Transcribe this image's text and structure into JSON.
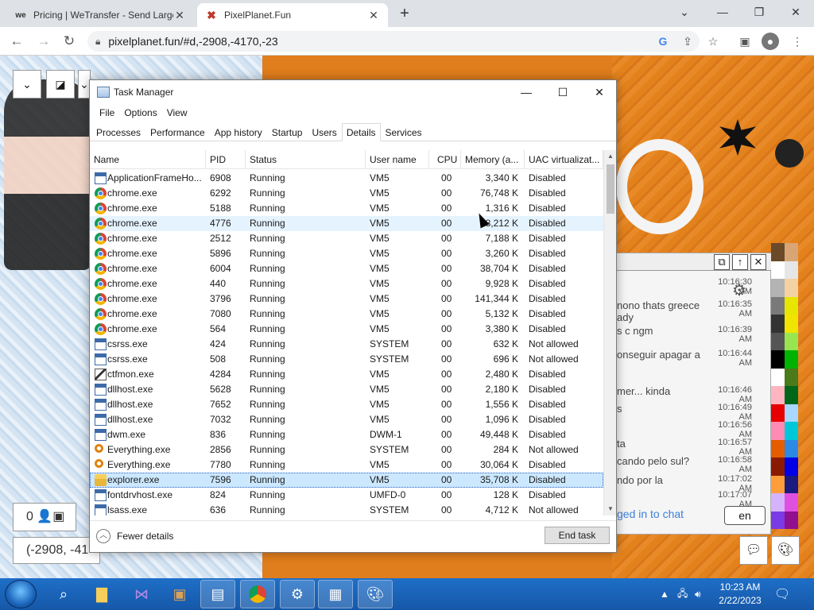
{
  "browser": {
    "tabs": [
      {
        "favicon": "we",
        "title": "Pricing | WeTransfer - Send Large"
      },
      {
        "favicon": "pixelplanet-icon",
        "title": "PixelPlanet.Fun"
      }
    ],
    "url": "pixelplanet.fun/#d,-2908,-4170,-23"
  },
  "pixelplanet": {
    "coords": "(-2908, -41",
    "online": "0",
    "chat": {
      "messages": [
        {
          "text": "",
          "time": "10:16:30 AM"
        },
        {
          "text": "nono thats greece",
          "text2": "ady",
          "time": "10:16:35 AM"
        },
        {
          "text": "s c ngm",
          "time": "10:16:39 AM"
        },
        {
          "text": "onseguir apagar a",
          "time": "10:16:44 AM"
        },
        {
          "text": "mer... kinda",
          "time": "10:16:46 AM"
        },
        {
          "text": "s",
          "time": "10:16:49 AM"
        },
        {
          "text": "",
          "time": "10:16:56 AM"
        },
        {
          "text": "ta",
          "time": "10:16:57 AM"
        },
        {
          "text": "cando pelo sul?",
          "time": "10:16:58 AM"
        },
        {
          "text": "ndo por la",
          "time": "10:17:02 AM"
        },
        {
          "text": "",
          "time": "10:17:07 AM"
        }
      ],
      "login_text": "ged in to chat",
      "lang": "en"
    },
    "palette": [
      "#6b4a2a",
      "#d8a675",
      "#ffffff",
      "#e6e6e6",
      "#b3b3b3",
      "#f3d1a1",
      "#7a7a7a",
      "#e6e600",
      "#333333",
      "#f0e400",
      "#555555",
      "#99e550",
      "#000000",
      "#00b300",
      "#ffffff",
      "#4a7a1a",
      "#ffb6c1",
      "#00661a",
      "#e60000",
      "#a8d8ff",
      "#ff8ab3",
      "#00c8d8",
      "#e65c00",
      "#2b8ae6",
      "#8a1a00",
      "#0000e6",
      "#ff9d3a",
      "#1a1a80",
      "#d6b3ff",
      "#e050e0",
      "#7a3ae6",
      "#901090"
    ]
  },
  "taskmanager": {
    "title": "Task Manager",
    "menu": [
      "File",
      "Options",
      "View"
    ],
    "tabs": [
      "Processes",
      "Performance",
      "App history",
      "Startup",
      "Users",
      "Details",
      "Services"
    ],
    "active_tab": "Details",
    "columns": [
      "Name",
      "PID",
      "Status",
      "User name",
      "CPU",
      "Memory (a...",
      "UAC virtualizat..."
    ],
    "rows": [
      {
        "icon": "app",
        "name": "ApplicationFrameHo...",
        "pid": "6908",
        "status": "Running",
        "user": "VM5",
        "cpu": "00",
        "mem": "3,340 K",
        "uac": "Disabled"
      },
      {
        "icon": "chrome",
        "name": "chrome.exe",
        "pid": "6292",
        "status": "Running",
        "user": "VM5",
        "cpu": "00",
        "mem": "76,748 K",
        "uac": "Disabled"
      },
      {
        "icon": "chrome",
        "name": "chrome.exe",
        "pid": "5188",
        "status": "Running",
        "user": "VM5",
        "cpu": "00",
        "mem": "1,316 K",
        "uac": "Disabled"
      },
      {
        "icon": "chrome",
        "name": "chrome.exe",
        "pid": "4776",
        "status": "Running",
        "user": "VM5",
        "cpu": "00",
        "mem": "8,212 K",
        "uac": "Disabled"
      },
      {
        "icon": "chrome",
        "name": "chrome.exe",
        "pid": "2512",
        "status": "Running",
        "user": "VM5",
        "cpu": "00",
        "mem": "7,188 K",
        "uac": "Disabled"
      },
      {
        "icon": "chrome",
        "name": "chrome.exe",
        "pid": "5896",
        "status": "Running",
        "user": "VM5",
        "cpu": "00",
        "mem": "3,260 K",
        "uac": "Disabled"
      },
      {
        "icon": "chrome",
        "name": "chrome.exe",
        "pid": "6004",
        "status": "Running",
        "user": "VM5",
        "cpu": "00",
        "mem": "38,704 K",
        "uac": "Disabled"
      },
      {
        "icon": "chrome",
        "name": "chrome.exe",
        "pid": "440",
        "status": "Running",
        "user": "VM5",
        "cpu": "00",
        "mem": "9,928 K",
        "uac": "Disabled"
      },
      {
        "icon": "chrome",
        "name": "chrome.exe",
        "pid": "3796",
        "status": "Running",
        "user": "VM5",
        "cpu": "00",
        "mem": "141,344 K",
        "uac": "Disabled"
      },
      {
        "icon": "chrome",
        "name": "chrome.exe",
        "pid": "7080",
        "status": "Running",
        "user": "VM5",
        "cpu": "00",
        "mem": "5,132 K",
        "uac": "Disabled"
      },
      {
        "icon": "chrome",
        "name": "chrome.exe",
        "pid": "564",
        "status": "Running",
        "user": "VM5",
        "cpu": "00",
        "mem": "3,380 K",
        "uac": "Disabled"
      },
      {
        "icon": "app",
        "name": "csrss.exe",
        "pid": "424",
        "status": "Running",
        "user": "SYSTEM",
        "cpu": "00",
        "mem": "632 K",
        "uac": "Not allowed"
      },
      {
        "icon": "app",
        "name": "csrss.exe",
        "pid": "508",
        "status": "Running",
        "user": "SYSTEM",
        "cpu": "00",
        "mem": "696 K",
        "uac": "Not allowed"
      },
      {
        "icon": "pen",
        "name": "ctfmon.exe",
        "pid": "4284",
        "status": "Running",
        "user": "VM5",
        "cpu": "00",
        "mem": "2,480 K",
        "uac": "Disabled"
      },
      {
        "icon": "app",
        "name": "dllhost.exe",
        "pid": "5628",
        "status": "Running",
        "user": "VM5",
        "cpu": "00",
        "mem": "2,180 K",
        "uac": "Disabled"
      },
      {
        "icon": "app",
        "name": "dllhost.exe",
        "pid": "7652",
        "status": "Running",
        "user": "VM5",
        "cpu": "00",
        "mem": "1,556 K",
        "uac": "Disabled"
      },
      {
        "icon": "app",
        "name": "dllhost.exe",
        "pid": "7032",
        "status": "Running",
        "user": "VM5",
        "cpu": "00",
        "mem": "1,096 K",
        "uac": "Disabled"
      },
      {
        "icon": "app",
        "name": "dwm.exe",
        "pid": "836",
        "status": "Running",
        "user": "DWM-1",
        "cpu": "00",
        "mem": "49,448 K",
        "uac": "Disabled"
      },
      {
        "icon": "search",
        "name": "Everything.exe",
        "pid": "2856",
        "status": "Running",
        "user": "SYSTEM",
        "cpu": "00",
        "mem": "284 K",
        "uac": "Not allowed"
      },
      {
        "icon": "search",
        "name": "Everything.exe",
        "pid": "7780",
        "status": "Running",
        "user": "VM5",
        "cpu": "00",
        "mem": "30,064 K",
        "uac": "Disabled"
      },
      {
        "icon": "folder",
        "name": "explorer.exe",
        "pid": "7596",
        "status": "Running",
        "user": "VM5",
        "cpu": "00",
        "mem": "35,708 K",
        "uac": "Disabled"
      },
      {
        "icon": "app",
        "name": "fontdrvhost.exe",
        "pid": "824",
        "status": "Running",
        "user": "UMFD-0",
        "cpu": "00",
        "mem": "128 K",
        "uac": "Disabled"
      },
      {
        "icon": "app",
        "name": "lsass.exe",
        "pid": "636",
        "status": "Running",
        "user": "SYSTEM",
        "cpu": "00",
        "mem": "4,712 K",
        "uac": "Not allowed"
      }
    ],
    "hover_row": 3,
    "selected_row": 20,
    "fewer_details": "Fewer details",
    "end_task": "End task"
  },
  "taskbar": {
    "time": "10:23 AM",
    "date": "2/22/2023"
  }
}
